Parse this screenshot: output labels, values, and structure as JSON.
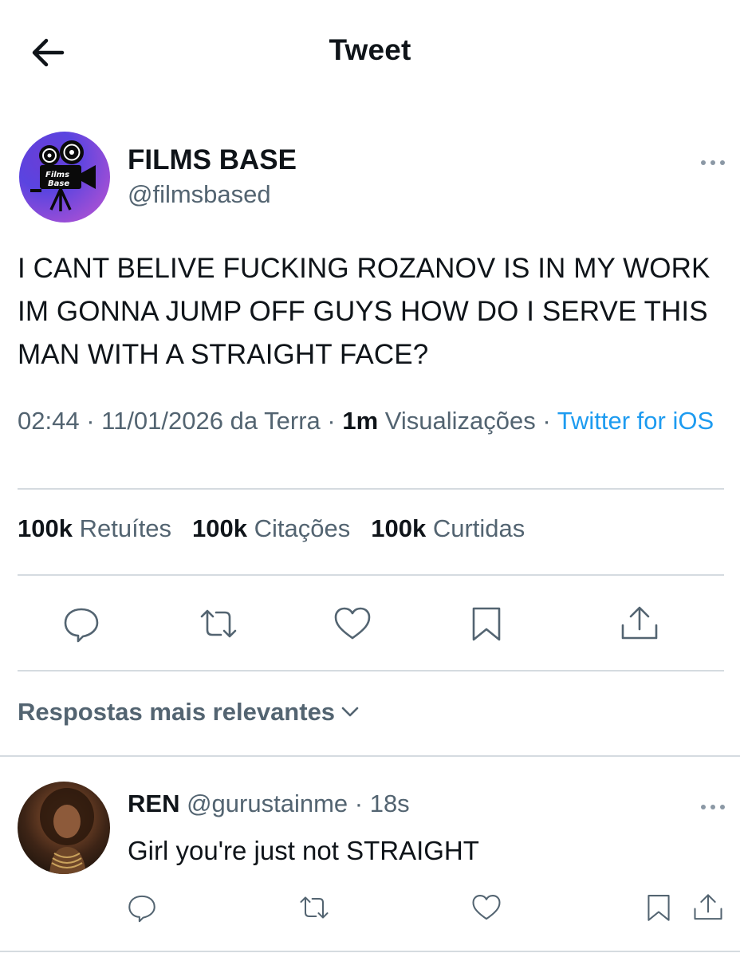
{
  "header": {
    "title": "Tweet",
    "back_icon": "arrow-left-icon"
  },
  "tweet": {
    "author": {
      "display_name": "FILMS BASE",
      "handle": "@filmsbased",
      "avatar_text_line1": "Films",
      "avatar_text_line2": "Base"
    },
    "text": "I CANT BELIVE FUCKING ROZANOV IS IN MY WORK IM GONNA JUMP OFF GUYS HOW DO I SERVE THIS MAN WITH A STRAIGHT FACE?",
    "meta": {
      "time": "02:44",
      "sep1": " · ",
      "date": "11/01/2026 da Terra",
      "sep2": " · ",
      "views_count": "1m",
      "views_label": " Visualizações",
      "sep3": " · ",
      "source": "Twitter for iOS"
    },
    "stats": [
      {
        "count": "100k",
        "label": "Retuítes"
      },
      {
        "count": "100k",
        "label": "Citações"
      },
      {
        "count": "100k",
        "label": "Curtidas"
      }
    ],
    "actions": [
      "reply-icon",
      "retweet-icon",
      "like-icon",
      "bookmark-icon",
      "share-icon"
    ]
  },
  "replies_sort": {
    "label": "Respostas mais relevantes",
    "icon": "chevron-down-icon"
  },
  "reply": {
    "display_name": "REN",
    "handle": "@gurustainme",
    "sep": " · ",
    "time": "18s",
    "text": "Girl you're just not STRAIGHT"
  },
  "colors": {
    "text": "#0f1419",
    "secondary": "#536471",
    "link": "#1d9bf0",
    "divider": "#d5dbe0"
  }
}
